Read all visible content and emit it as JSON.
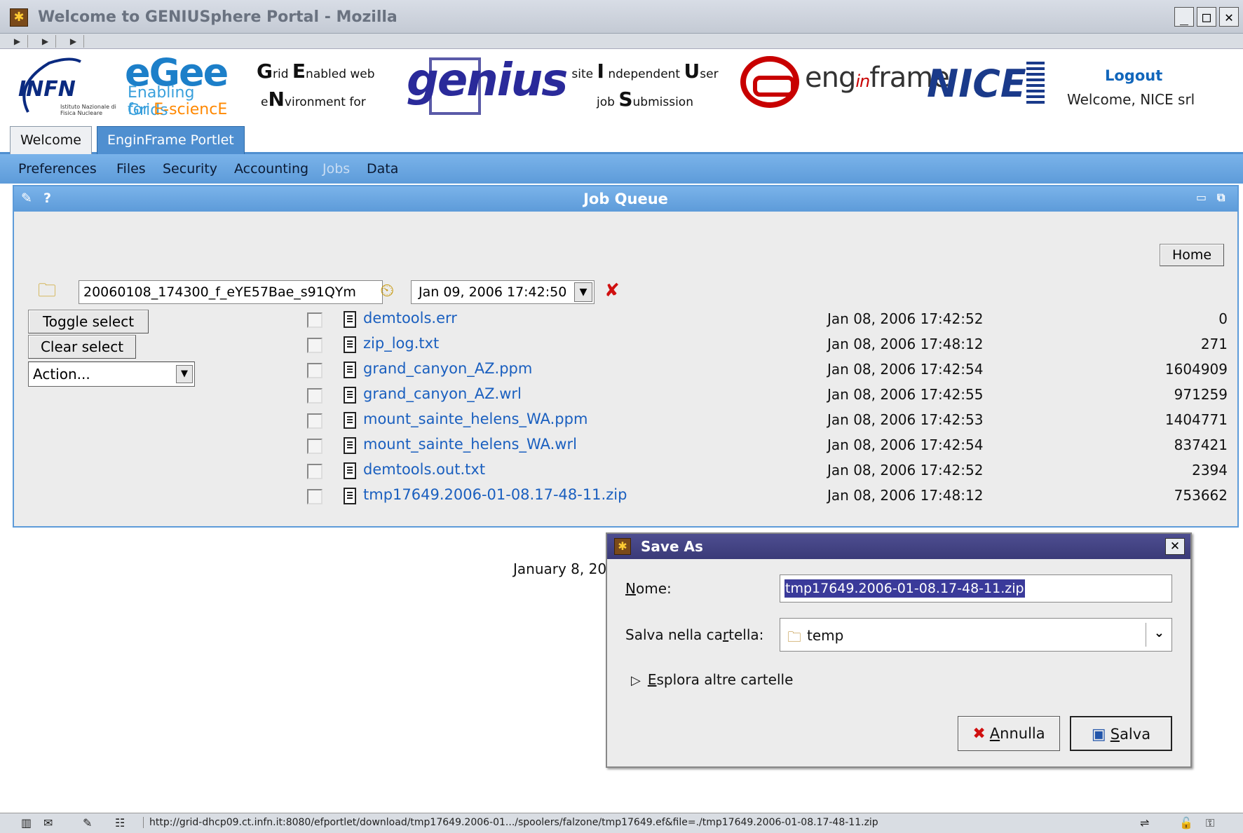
{
  "window": {
    "title": "Welcome to GENIUSphere Portal - Mozilla",
    "minimize": "_",
    "maximize": "□",
    "close": "✕"
  },
  "header": {
    "infn": {
      "name": "INFN",
      "subtitle": "Istituto Nazionale di Fisica Nucleare"
    },
    "egee": {
      "name": "eGee",
      "line1": "Enabling Grids",
      "line2_pre": "for ",
      "line2_post": "E-sciencE"
    },
    "genius_left": {
      "line1_caps": [
        "G",
        "E"
      ],
      "line1": [
        "rid ",
        "nabled web"
      ],
      "line2_caps": "N",
      "line2_pre": "e",
      "line2": "vironment for"
    },
    "genius_logo": "genius",
    "genius_right": {
      "l1a": "site ",
      "l1b": "I",
      "l1c": " ndependent ",
      "l1d": "U",
      "l1e": "ser",
      "l2a": "job ",
      "l2b": "S",
      "l2c": "ubmission"
    },
    "enginframe": {
      "pre": "eng",
      "mid": "in",
      "post": "frame"
    },
    "nice_logo": "NICE",
    "logout": "Logout",
    "welcome_user": "Welcome, NICE srl"
  },
  "tabs": [
    {
      "label": "Welcome",
      "active": false
    },
    {
      "label": "EnginFrame Portlet",
      "active": true
    }
  ],
  "menu": [
    {
      "label": "Preferences",
      "active": true
    },
    {
      "label": "Files",
      "active": true
    },
    {
      "label": "Security",
      "active": true
    },
    {
      "label": "Accounting",
      "active": true
    },
    {
      "label": "Jobs",
      "active": false
    },
    {
      "label": "Data",
      "active": true
    }
  ],
  "panel": {
    "title": "Job Queue",
    "home_label": "Home",
    "job_id": "20060108_174300_f_eYE57Bae_s91QYm",
    "expiry_date": "Jan 09, 2006 17:42:50",
    "toggle_label": "Toggle select",
    "clear_label": "Clear select",
    "action_value": "Action...",
    "files": [
      {
        "name": "demtools.err",
        "date": "Jan 08, 2006 17:42:52",
        "size": "0"
      },
      {
        "name": "zip_log.txt",
        "date": "Jan 08, 2006 17:48:12",
        "size": "271"
      },
      {
        "name": "grand_canyon_AZ.ppm",
        "date": "Jan 08, 2006 17:42:54",
        "size": "1604909"
      },
      {
        "name": "grand_canyon_AZ.wrl",
        "date": "Jan 08, 2006 17:42:55",
        "size": "971259"
      },
      {
        "name": "mount_sainte_helens_WA.ppm",
        "date": "Jan 08, 2006 17:42:53",
        "size": "1404771"
      },
      {
        "name": "mount_sainte_helens_WA.wrl",
        "date": "Jan 08, 2006 17:42:54",
        "size": "837421"
      },
      {
        "name": "demtools.out.txt",
        "date": "Jan 08, 2006 17:42:52",
        "size": "2394"
      },
      {
        "name": "tmp17649.2006-01-08.17-48-11.zip",
        "date": "Jan 08, 2006 17:48:12",
        "size": "753662"
      }
    ]
  },
  "footer_date": "January 8, 20",
  "dialog": {
    "title": "Save As",
    "name_label_u": "N",
    "name_label_rest": "ome:",
    "name_value": "tmp17649.2006-01-08.17-48-11.zip",
    "folder_label_pre": "Salva nella ca",
    "folder_label_u": "r",
    "folder_label_post": "tella:",
    "folder_value": "temp",
    "expander_u": "E",
    "expander_rest": "splora altre cartelle",
    "cancel_u": "A",
    "cancel_rest": "nnulla",
    "save_u": "S",
    "save_rest": "alva"
  },
  "statusbar": {
    "url": "http://grid-dhcp09.ct.infn.it:8080/efportlet/download/tmp17649.2006-01.../spoolers/falzone/tmp17649.ef&file=./tmp17649.2006-01-08.17-48-11.zip"
  },
  "icons": {
    "app": "mozilla-icon",
    "refresh": "folder-refresh-icon",
    "clock": "folder-clock-icon",
    "delete": "folder-delete-icon"
  }
}
